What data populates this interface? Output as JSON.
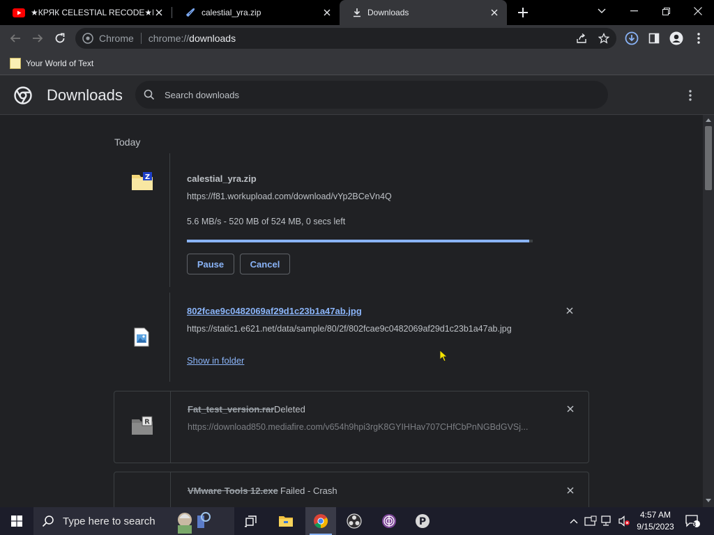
{
  "tabs": [
    {
      "title": "★КРЯК CELESTIAL RECODE★КРЯ",
      "icon": "youtube-icon",
      "active": false
    },
    {
      "title": "calestial_yra.zip",
      "icon": "rocket-icon",
      "active": false
    },
    {
      "title": "Downloads",
      "icon": "download-icon",
      "active": true
    }
  ],
  "omnibox": {
    "site_label": "Chrome",
    "url_scheme": "chrome://",
    "url_host": "downloads"
  },
  "bookmarks": [
    {
      "label": "Your World of Text"
    }
  ],
  "downloads_page": {
    "title": "Downloads",
    "search_placeholder": "Search downloads"
  },
  "section_date": "Today",
  "downloads": [
    {
      "file_name": "calestial_yra.zip",
      "url": "https://f81.workupload.com/download/vYp2BCeVn4Q",
      "status": "5.6 MB/s - 520 MB of 524 MB, 0 secs left",
      "progress": 0.99,
      "pause_label": "Pause",
      "cancel_label": "Cancel",
      "state": "in-progress"
    },
    {
      "file_name": "802fcae9c0482069af29d1c23b1a47ab.jpg",
      "url": "https://static1.e621.net/data/sample/80/2f/802fcae9c0482069af29d1c23b1a47ab.jpg",
      "action_label": "Show in folder",
      "state": "complete"
    },
    {
      "file_name": "Fat_test_version.rar",
      "tag": "Deleted",
      "url": "https://download850.mediafire.com/v654h9hpi3rgK8GYIHHav707CHfCbPnNGBdGVSj...",
      "state": "deleted"
    },
    {
      "file_name": "VMware Tools 12.exe",
      "tag": "Failed - Crash",
      "state": "failed"
    }
  ],
  "taskbar": {
    "search_placeholder": "Type here to search",
    "clock_time": "4:57 AM",
    "clock_date": "9/15/2023",
    "notification_count": "3"
  },
  "colors": {
    "accent": "#8ab4f8",
    "background": "#202124",
    "toolbar": "#35363a"
  }
}
